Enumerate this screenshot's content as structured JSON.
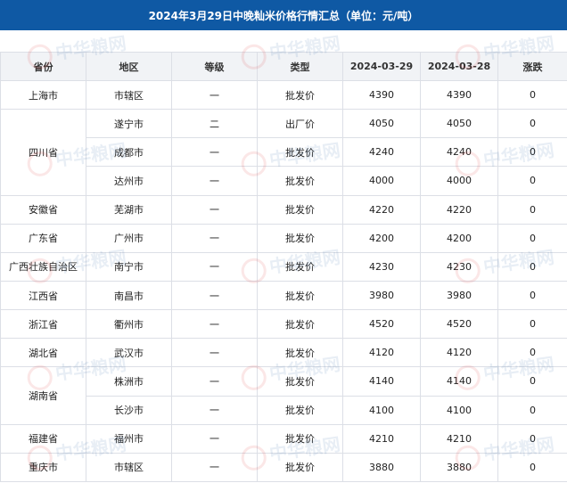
{
  "title": "2024年3月29日中晚籼米价格行情汇总（单位：元/吨）",
  "columns": [
    "省份",
    "地区",
    "等级",
    "类型",
    "2024-03-29",
    "2024-03-28",
    "涨跌"
  ],
  "rows": [
    {
      "province": "上海市",
      "area": "市辖区",
      "grade": "一",
      "type": "批发价",
      "p1": "4390",
      "p2": "4390",
      "change": "0"
    },
    {
      "province": "四川省",
      "area": "遂宁市",
      "grade": "二",
      "type": "出厂价",
      "p1": "4050",
      "p2": "4050",
      "change": "0"
    },
    {
      "province": "",
      "area": "成都市",
      "grade": "一",
      "type": "批发价",
      "p1": "4240",
      "p2": "4240",
      "change": "0"
    },
    {
      "province": "",
      "area": "达州市",
      "grade": "一",
      "type": "批发价",
      "p1": "4000",
      "p2": "4000",
      "change": "0"
    },
    {
      "province": "安徽省",
      "area": "芜湖市",
      "grade": "一",
      "type": "批发价",
      "p1": "4220",
      "p2": "4220",
      "change": "0"
    },
    {
      "province": "广东省",
      "area": "广州市",
      "grade": "一",
      "type": "批发价",
      "p1": "4200",
      "p2": "4200",
      "change": "0"
    },
    {
      "province": "广西壮族自治区",
      "area": "南宁市",
      "grade": "一",
      "type": "批发价",
      "p1": "4230",
      "p2": "4230",
      "change": "0"
    },
    {
      "province": "江西省",
      "area": "南昌市",
      "grade": "一",
      "type": "批发价",
      "p1": "3980",
      "p2": "3980",
      "change": "0"
    },
    {
      "province": "浙江省",
      "area": "衢州市",
      "grade": "一",
      "type": "批发价",
      "p1": "4520",
      "p2": "4520",
      "change": "0"
    },
    {
      "province": "湖北省",
      "area": "武汉市",
      "grade": "一",
      "type": "批发价",
      "p1": "4120",
      "p2": "4120",
      "change": "0"
    },
    {
      "province": "湖南省",
      "area": "株洲市",
      "grade": "一",
      "type": "批发价",
      "p1": "4140",
      "p2": "4140",
      "change": "0"
    },
    {
      "province": "",
      "area": "长沙市",
      "grade": "一",
      "type": "批发价",
      "p1": "4100",
      "p2": "4100",
      "change": "0"
    },
    {
      "province": "福建省",
      "area": "福州市",
      "grade": "一",
      "type": "批发价",
      "p1": "4210",
      "p2": "4210",
      "change": "0"
    },
    {
      "province": "重庆市",
      "area": "市辖区",
      "grade": "一",
      "type": "批发价",
      "p1": "3880",
      "p2": "3880",
      "change": "0"
    }
  ],
  "watermark_text": "中华粮网"
}
